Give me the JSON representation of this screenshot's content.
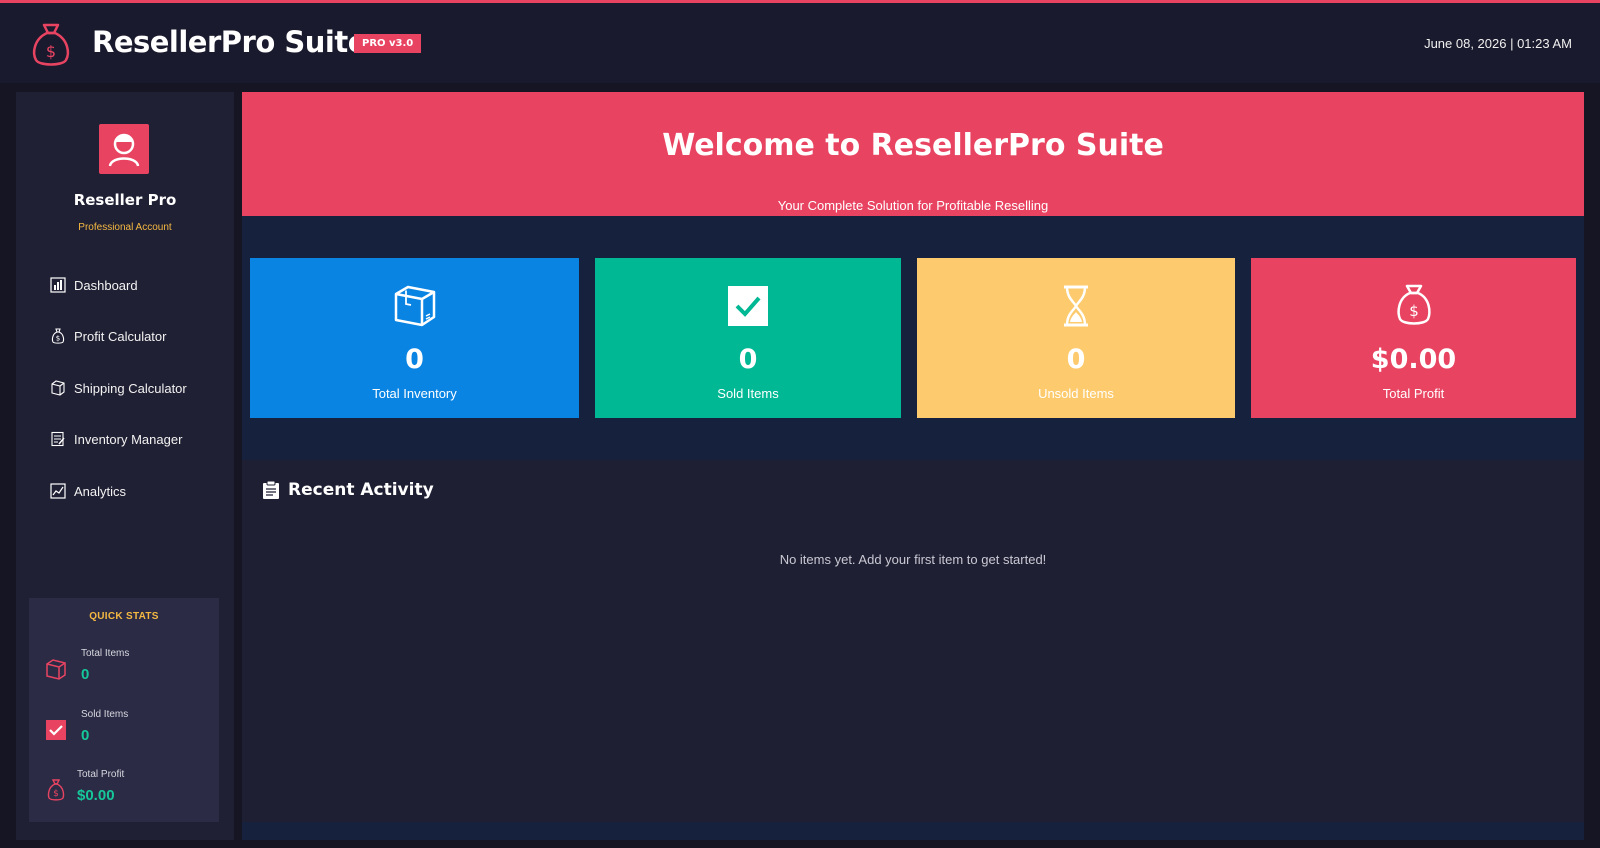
{
  "header": {
    "logo_icon": "money-bag-icon",
    "title": "ResellerPro Suite",
    "badge": "PRO v3.0",
    "datetime": "June 08, 2026 | 01:23 AM"
  },
  "sidebar": {
    "profile": {
      "avatar_icon": "user-avatar-icon",
      "name": "Reseller Pro",
      "account_type": "Professional Account"
    },
    "nav": [
      {
        "label": "Dashboard",
        "icon": "bar-chart-icon"
      },
      {
        "label": "Profit Calculator",
        "icon": "money-bag-icon"
      },
      {
        "label": "Shipping Calculator",
        "icon": "package-icon"
      },
      {
        "label": "Inventory Manager",
        "icon": "memo-icon"
      },
      {
        "label": "Analytics",
        "icon": "line-chart-icon"
      }
    ],
    "quick_stats": {
      "title": "QUICK STATS",
      "items": [
        {
          "label": "Total Items",
          "value": "0",
          "icon": "package-icon"
        },
        {
          "label": "Sold Items",
          "value": "0",
          "icon": "check-box-icon"
        },
        {
          "label": "Total Profit",
          "value": "$0.00",
          "icon": "money-bag-icon"
        }
      ]
    }
  },
  "banner": {
    "title": "Welcome to ResellerPro Suite",
    "subtitle": "Your Complete Solution for Profitable Reselling"
  },
  "stats": [
    {
      "value": "0",
      "label": "Total Inventory",
      "icon": "package-icon",
      "color": "#0984e3"
    },
    {
      "value": "0",
      "label": "Sold Items",
      "icon": "check-box-icon",
      "color": "#00b894"
    },
    {
      "value": "0",
      "label": "Unsold Items",
      "icon": "hourglass-icon",
      "color": "#fdcb6e"
    },
    {
      "value": "$0.00",
      "label": "Total Profit",
      "icon": "money-bag-icon",
      "color": "#e84462"
    }
  ],
  "activity": {
    "title": "Recent Activity",
    "icon": "clipboard-icon",
    "empty_message": "No items yet. Add your first item to get started!"
  },
  "colors": {
    "accent": "#e84462",
    "background": "#1a1a2e",
    "panel": "#16213e",
    "highlight_value": "#16c79a",
    "gold": "#f5b942"
  }
}
